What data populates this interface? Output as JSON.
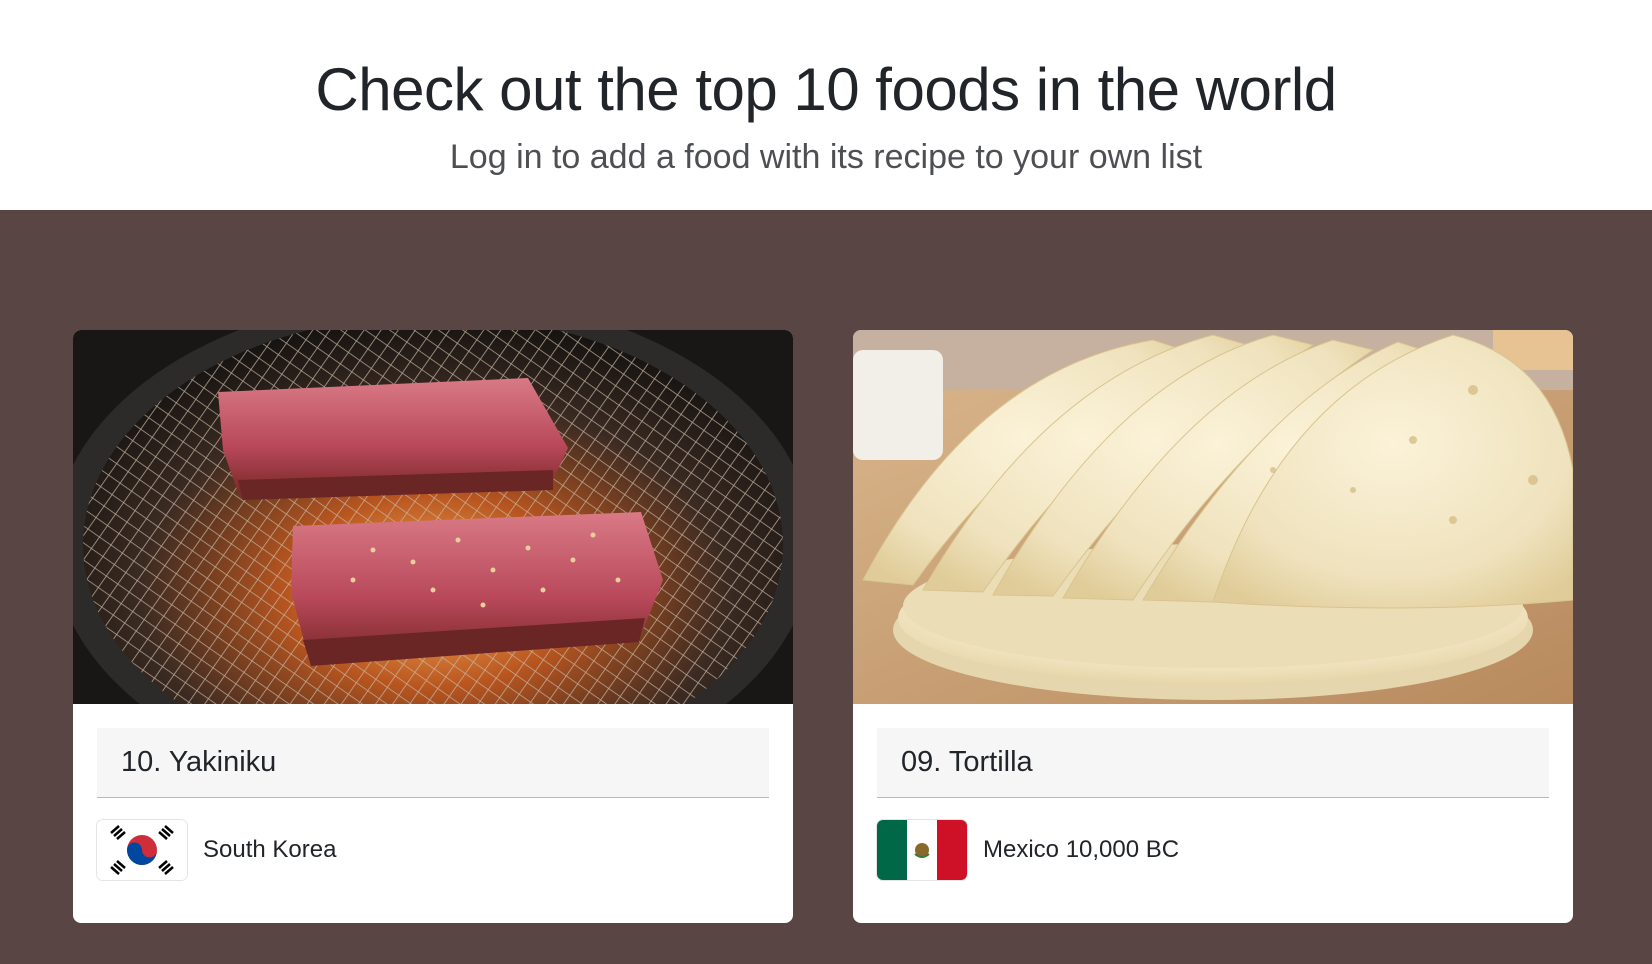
{
  "hero": {
    "title": "Check out the top 10 foods in the world",
    "subtitle": "Log in to add a food with its recipe to your own list"
  },
  "colors": {
    "band_background": "#5a4545",
    "card_background": "#ffffff",
    "title_box_background": "#f6f6f6"
  },
  "foods": [
    {
      "title": "10. Yakiniku",
      "origin": "South Korea",
      "image": "grilled-wagyu-photo",
      "flag": "south-korea-flag-icon"
    },
    {
      "title": "09. Tortilla",
      "origin": "Mexico 10,000 BC",
      "image": "tortillas-photo",
      "flag": "mexico-flag-icon"
    }
  ]
}
